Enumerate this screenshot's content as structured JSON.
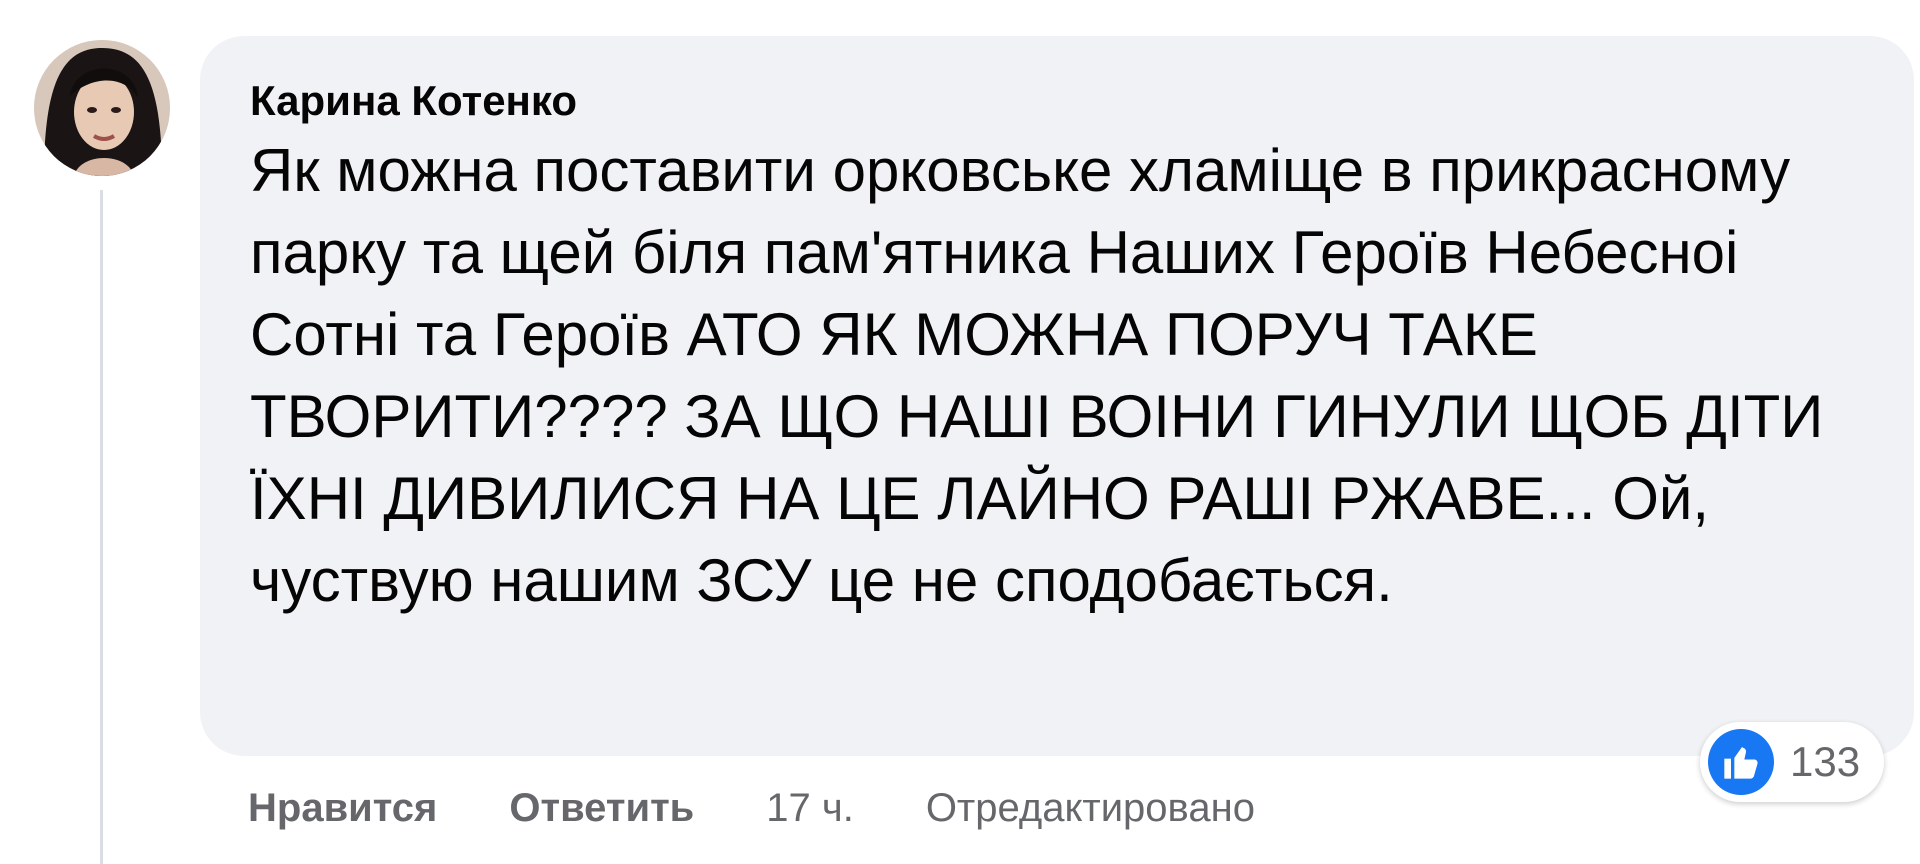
{
  "comment": {
    "author": "Карина Котенко",
    "text": "Як можна поставити орковське хламіще в прикрасному парку та щей біля пам'ятника Наших Героїв Небесноі Сотні та Героїв АТО ЯК МОЖНА ПОРУЧ ТАКЕ ТВОРИТИ???? ЗА ЩО НАШІ ВОІНИ ГИНУЛИ ЩОБ ДІТИ ЇХНІ ДИВИЛИСЯ НА ЦЕ ЛАЙНО РАШІ РЖАВЕ... Ой, чуствую нашим ЗСУ це не сподобається.",
    "reaction_icon": "like-icon",
    "reaction_count": "133"
  },
  "actions": {
    "like_label": "Нравится",
    "reply_label": "Ответить",
    "time": "17 ч.",
    "edited_label": "Отредактировано"
  },
  "colors": {
    "bubble": "#f0f2f5",
    "text": "#050505",
    "secondary": "#65676b",
    "like_blue": "#1877f2"
  }
}
